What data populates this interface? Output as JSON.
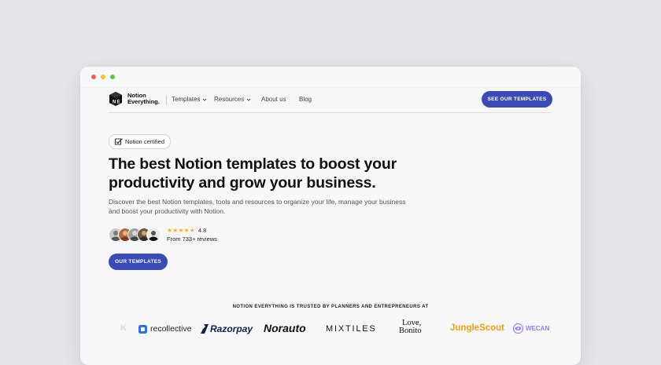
{
  "nav": {
    "logo_line1": "Notion",
    "logo_line2": "Everything.",
    "items": [
      {
        "label": "Templates",
        "has_dropdown": true
      },
      {
        "label": "Resources",
        "has_dropdown": true
      },
      {
        "label": "About us",
        "has_dropdown": false
      },
      {
        "label": "Blog",
        "has_dropdown": false
      }
    ],
    "cta_label": "SEE OUR TEMPLATES"
  },
  "hero": {
    "badge_label": "Notion certified",
    "headline": "The best Notion templates to boost your productivity and grow your business.",
    "subtitle": "Discover the best Notion templates, tools and resources to organize your life, manage your business and boost your productivity with Notion.",
    "rating": "4.8",
    "star_count": 5,
    "reviews_text": "From 733+ reviews",
    "cta_label": "OUR TEMPLATES"
  },
  "trusted": {
    "heading": "NOTION EVERYTHING IS TRUSTED BY PLANNERS AND ENTREPRENEURS AT",
    "logos": {
      "partial_left": "K",
      "recollective": "recollective",
      "razorpay": "Razorpay",
      "norauto": "Norauto",
      "mixtiles": "MIXTILES",
      "lovebonito_line1": "Love,",
      "lovebonito_line2": "Bonito",
      "junglescout": "JungleScout",
      "wecan": "WECAN"
    }
  },
  "colors": {
    "accent": "#3c4bb3",
    "page_bg": "#e5e6ea",
    "window_bg": "#f7f7f9",
    "star": "#f3b324",
    "junglescout_orange": "#f39c12",
    "recollective_blue": "#3b6fd8",
    "wecan_purple": "#7a5ad6"
  }
}
